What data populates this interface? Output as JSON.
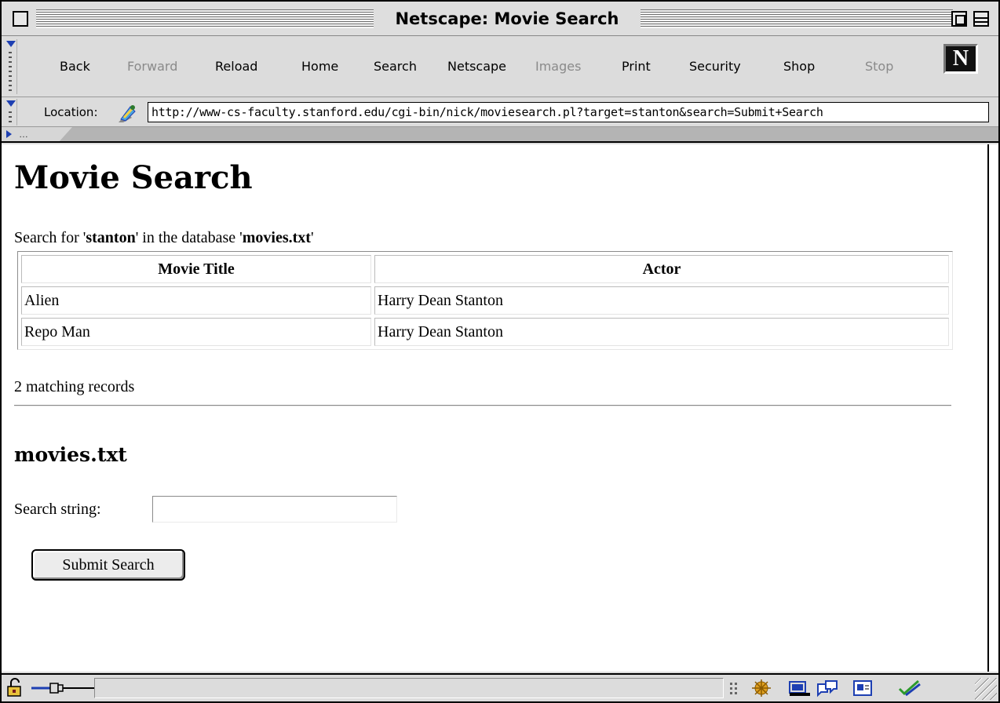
{
  "window": {
    "title": "Netscape: Movie Search"
  },
  "toolbar": {
    "buttons": [
      {
        "label": "Back",
        "enabled": true
      },
      {
        "label": "Forward",
        "enabled": false
      },
      {
        "label": "Reload",
        "enabled": true
      },
      {
        "label": "Home",
        "enabled": true
      },
      {
        "label": "Search",
        "enabled": true
      },
      {
        "label": "Netscape",
        "enabled": true
      },
      {
        "label": "Images",
        "enabled": false
      },
      {
        "label": "Print",
        "enabled": true
      },
      {
        "label": "Security",
        "enabled": true
      },
      {
        "label": "Shop",
        "enabled": true
      },
      {
        "label": "Stop",
        "enabled": false
      }
    ],
    "logo_letter": "N"
  },
  "location": {
    "label": "Location:",
    "url": "http://www-cs-faculty.stanford.edu/cgi-bin/nick/moviesearch.pl?target=stanton&search=Submit+Search"
  },
  "personal_toolbar": {
    "collapsed_text": "…"
  },
  "page": {
    "title": "Movie Search",
    "summary": {
      "prefix": "Search for '",
      "term": "stanton",
      "middle": "' in the database '",
      "database": "movies.txt",
      "suffix": "'"
    },
    "results": {
      "headers": [
        "Movie Title",
        "Actor"
      ],
      "rows": [
        [
          "Alien",
          "Harry Dean Stanton"
        ],
        [
          "Repo Man",
          "Harry Dean Stanton"
        ]
      ]
    },
    "match_count": "2 matching records",
    "form": {
      "title": "movies.txt",
      "search_label": "Search string:",
      "search_value": "",
      "submit_label": "Submit Search"
    }
  },
  "status": {
    "text": "",
    "icons": [
      "security-lock-icon",
      "connection-icon",
      "component-bar-icon",
      "navigator-icon",
      "mail-icon",
      "discussion-icon",
      "composer-icon",
      "edit-icon"
    ]
  },
  "colors": {
    "chrome": "#dcdcdc",
    "accent_blue": "#1d3fb2",
    "disabled_text": "#8a8a8a"
  }
}
